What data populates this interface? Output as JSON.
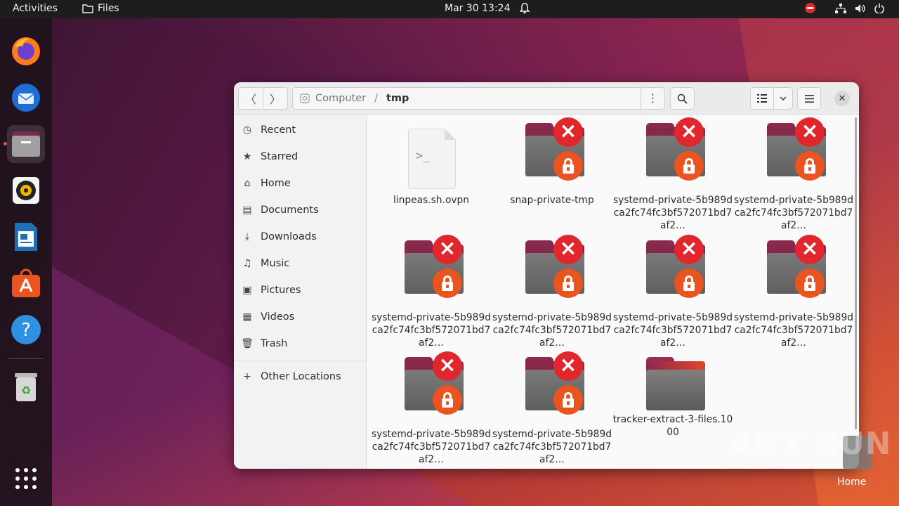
{
  "topbar": {
    "activities": "Activities",
    "app_name": "Files",
    "clock": "Mar 30  13:24"
  },
  "dock": {
    "items": [
      "firefox",
      "thunderbird",
      "files",
      "rhythmbox",
      "libreoffice-writer",
      "app-center",
      "help",
      "trash"
    ]
  },
  "window": {
    "path": [
      "Computer",
      "tmp"
    ]
  },
  "sidebar": {
    "items": [
      {
        "label": "Recent",
        "icon": "clock-icon"
      },
      {
        "label": "Starred",
        "icon": "star-icon"
      },
      {
        "label": "Home",
        "icon": "home-icon"
      },
      {
        "label": "Documents",
        "icon": "document-icon"
      },
      {
        "label": "Downloads",
        "icon": "download-icon"
      },
      {
        "label": "Music",
        "icon": "music-icon"
      },
      {
        "label": "Pictures",
        "icon": "picture-icon"
      },
      {
        "label": "Videos",
        "icon": "video-icon"
      },
      {
        "label": "Trash",
        "icon": "trash-icon"
      }
    ],
    "other_locations": "Other Locations"
  },
  "files": [
    {
      "name": "linpeas.sh.ovpn",
      "type": "script"
    },
    {
      "name": "snap-private-tmp",
      "type": "locked-folder"
    },
    {
      "name": "systemd-private-5b989dca2fc74fc3bf572071bd7af2…",
      "type": "locked-folder"
    },
    {
      "name": "systemd-private-5b989dca2fc74fc3bf572071bd7af2…",
      "type": "locked-folder"
    },
    {
      "name": "systemd-private-5b989dca2fc74fc3bf572071bd7af2…",
      "type": "locked-folder"
    },
    {
      "name": "systemd-private-5b989dca2fc74fc3bf572071bd7af2…",
      "type": "locked-folder"
    },
    {
      "name": "systemd-private-5b989dca2fc74fc3bf572071bd7af2…",
      "type": "locked-folder"
    },
    {
      "name": "systemd-private-5b989dca2fc74fc3bf572071bd7af2…",
      "type": "locked-folder"
    },
    {
      "name": "systemd-private-5b989dca2fc74fc3bf572071bd7af2…",
      "type": "locked-folder"
    },
    {
      "name": "systemd-private-5b989dca2fc74fc3bf572071bd7af2…",
      "type": "locked-folder"
    },
    {
      "name": "tracker-extract-3-files.1000",
      "type": "folder"
    }
  ],
  "desktop": {
    "home_label": "Home",
    "watermark": "ANY RUN"
  },
  "colors": {
    "accent": "#e95420",
    "error": "#e0272d",
    "folder_tab": "#86284a"
  }
}
